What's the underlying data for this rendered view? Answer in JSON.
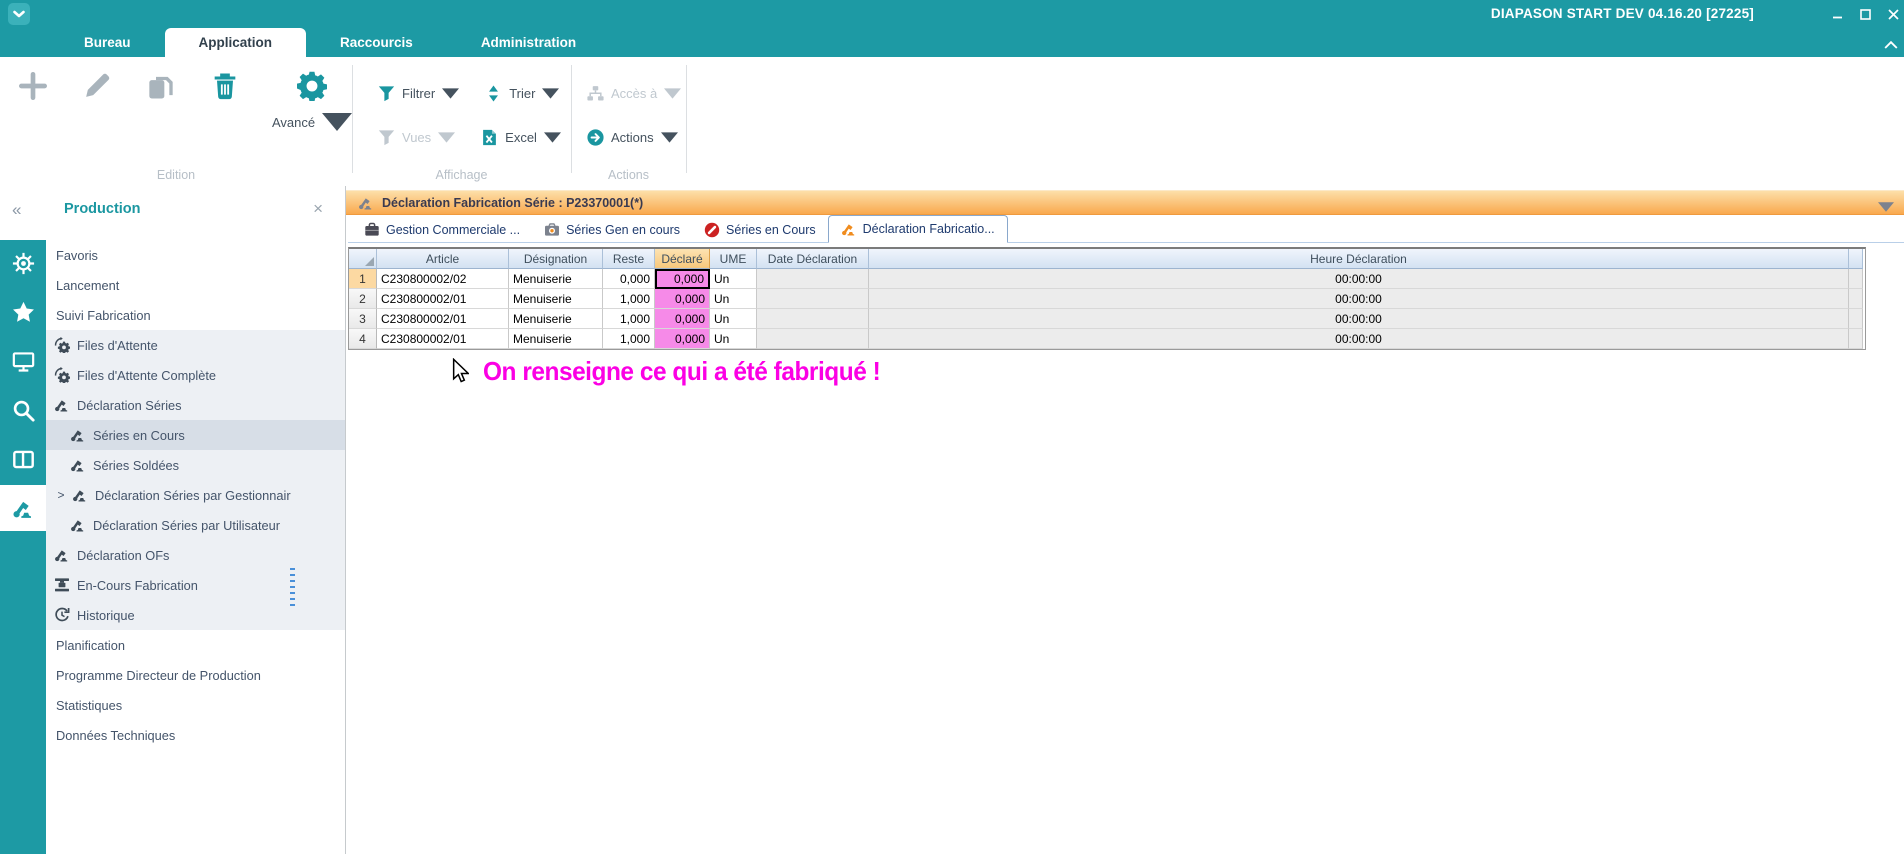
{
  "window": {
    "title": "DIAPASON START DEV 04.16.20 [27225]",
    "controls": [
      "minimize",
      "maximize",
      "close"
    ]
  },
  "ribbon": {
    "tabs": [
      {
        "label": "Bureau",
        "active": false
      },
      {
        "label": "Application",
        "active": true
      },
      {
        "label": "Raccourcis",
        "active": false
      },
      {
        "label": "Administration",
        "active": false
      }
    ]
  },
  "toolbar": {
    "edition": {
      "group_label": "Edition",
      "buttons": [
        {
          "name": "add",
          "icon": "plus-icon",
          "enabled": false
        },
        {
          "name": "edit",
          "icon": "pencil-icon",
          "enabled": false
        },
        {
          "name": "copy",
          "icon": "copy-icon",
          "enabled": false
        },
        {
          "name": "delete",
          "icon": "trash-icon",
          "enabled": true
        }
      ],
      "advanced_label": "Avancé"
    },
    "affichage": {
      "group_label": "Affichage",
      "filter_label": "Filtrer",
      "sort_label": "Trier",
      "views_label": "Vues",
      "excel_label": "Excel"
    },
    "actions": {
      "group_label": "Actions",
      "access_label": "Accès à",
      "actions_label": "Actions"
    }
  },
  "sidebar": {
    "title": "Production",
    "rail_icons": [
      {
        "icon": "wheel",
        "active": false
      },
      {
        "icon": "star",
        "active": false
      },
      {
        "icon": "monitor",
        "active": false
      },
      {
        "icon": "search",
        "active": false
      },
      {
        "icon": "columns",
        "active": false
      },
      {
        "icon": "robot-arm",
        "active": true
      }
    ],
    "items": [
      {
        "label": "Favoris",
        "zone": "plain",
        "indent": 0
      },
      {
        "label": "Lancement",
        "zone": "plain",
        "indent": 0
      },
      {
        "label": "Suivi Fabrication",
        "zone": "plain",
        "indent": 0
      },
      {
        "label": "Files d'Attente",
        "zone": "group",
        "icon": "queue-gear",
        "indent": 0
      },
      {
        "label": "Files d'Attente Complète",
        "zone": "group",
        "icon": "queue-gear",
        "indent": 0
      },
      {
        "label": "Déclaration Séries",
        "zone": "group",
        "icon": "robot-arm",
        "indent": 0
      },
      {
        "label": "Séries en Cours",
        "zone": "group",
        "icon": "robot-arm",
        "indent": 1,
        "selected": true
      },
      {
        "label": "Séries Soldées",
        "zone": "group",
        "icon": "robot-arm",
        "indent": 1
      },
      {
        "label": "Déclaration Séries par Gestionnair",
        "zone": "group",
        "icon": "robot-arm",
        "indent": 1,
        "expandable": true
      },
      {
        "label": "Déclaration Séries par Utilisateur",
        "zone": "group",
        "icon": "robot-arm",
        "indent": 1
      },
      {
        "label": "Déclaration OFs",
        "zone": "group",
        "icon": "robot-arm",
        "indent": 0
      },
      {
        "label": "En-Cours Fabrication",
        "zone": "group",
        "icon": "machine",
        "indent": 0
      },
      {
        "label": "Historique",
        "zone": "group",
        "icon": "history",
        "indent": 0
      },
      {
        "label": "Planification",
        "zone": "plain",
        "indent": 0
      },
      {
        "label": "Programme Directeur de Production",
        "zone": "plain",
        "indent": 0
      },
      {
        "label": "Statistiques",
        "zone": "plain",
        "indent": 0
      },
      {
        "label": "Données Techniques",
        "zone": "plain",
        "indent": 0
      }
    ]
  },
  "workspace": {
    "banner": {
      "icon": "robot-arm",
      "title": "Déclaration Fabrication Série : P23370001(*)"
    },
    "doc_tabs": [
      {
        "label": "Gestion Commerciale ...",
        "icon": "briefcase",
        "active": false
      },
      {
        "label": "Séries Gen en cours",
        "icon": "camera",
        "active": false
      },
      {
        "label": "Séries en Cours",
        "icon": "forbidden",
        "active": false
      },
      {
        "label": "Déclaration Fabricatio...",
        "icon": "robot-arm",
        "active": true
      }
    ],
    "table": {
      "columns": [
        "Article",
        "Désignation",
        "Reste",
        "Déclaré",
        "UME",
        "Date Déclaration",
        "Heure Déclaration"
      ],
      "highlighted_column": "Déclaré",
      "selected_cell": {
        "row": 1,
        "column": "Déclaré"
      },
      "rows": [
        {
          "num": "1",
          "article": "C230800002/02",
          "designation": "Menuiserie",
          "reste": "0,000",
          "declare": "0,000",
          "ume": "Un",
          "date": "",
          "heure": "00:00:00"
        },
        {
          "num": "2",
          "article": "C230800002/01",
          "designation": "Menuiserie",
          "reste": "1,000",
          "declare": "0,000",
          "ume": "Un",
          "date": "",
          "heure": "00:00:00"
        },
        {
          "num": "3",
          "article": "C230800002/01",
          "designation": "Menuiserie",
          "reste": "1,000",
          "declare": "0,000",
          "ume": "Un",
          "date": "",
          "heure": "00:00:00"
        },
        {
          "num": "4",
          "article": "C230800002/01",
          "designation": "Menuiserie",
          "reste": "1,000",
          "declare": "0,000",
          "ume": "Un",
          "date": "",
          "heure": "00:00:00"
        }
      ]
    },
    "annotation": "On renseigne ce qui a été fabriqué !"
  },
  "colors": {
    "titlebar_teal": "#1d9aa4",
    "banner_orange": "#f9a94e",
    "declared_pink": "#f68ae8",
    "annotation_magenta": "#fb00e4",
    "current_row_orange": "#fcd9a2"
  }
}
